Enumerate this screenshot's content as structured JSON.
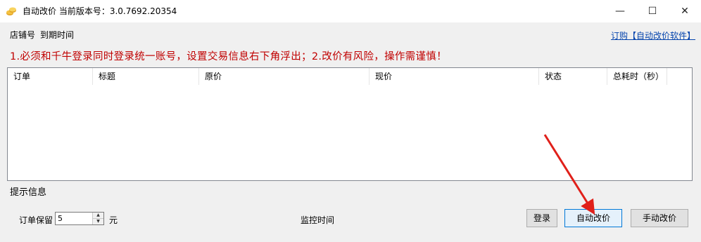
{
  "window": {
    "title": "自动改价   当前版本号：3.0.7692.20354",
    "controls": {
      "minimize": "—",
      "maximize": "☐",
      "close": "✕"
    }
  },
  "header": {
    "store_label": "店铺号",
    "expire_label": "到期时间",
    "order_link": "订购【自动改价软件】"
  },
  "warning_text": "1.必须和千牛登录同时登录统一账号，设置交易信息右下角浮出；2.改价有风险，操作需谨慎！",
  "table": {
    "columns": [
      "订单",
      "标题",
      "原价",
      "现价",
      "状态",
      "总耗时（秒）"
    ]
  },
  "hint_label": "提示信息",
  "footer": {
    "keep_label": "订单保留",
    "keep_value": "5",
    "unit": "元",
    "monitor_label": "监控时间",
    "login_button": "登录",
    "auto_button": "自动改价",
    "manual_button": "手动改价"
  },
  "colors": {
    "warning": "#c00000",
    "link": "#0645ad",
    "arrow": "#e0201a",
    "primary_border": "#0078d7"
  },
  "icons": {
    "app": "coin-stack-icon",
    "arrow": "red-arrow-annotation"
  }
}
